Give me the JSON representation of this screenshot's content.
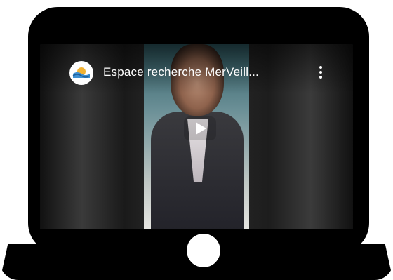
{
  "video": {
    "title": "Espace recherche MerVeill...",
    "channel_avatar_icon": "channel-logo-icon",
    "menu_icon": "more-vert-icon",
    "play_icon": "play-icon"
  },
  "colors": {
    "device": "#000000",
    "background": "#ffffff",
    "text": "#ffffff"
  }
}
